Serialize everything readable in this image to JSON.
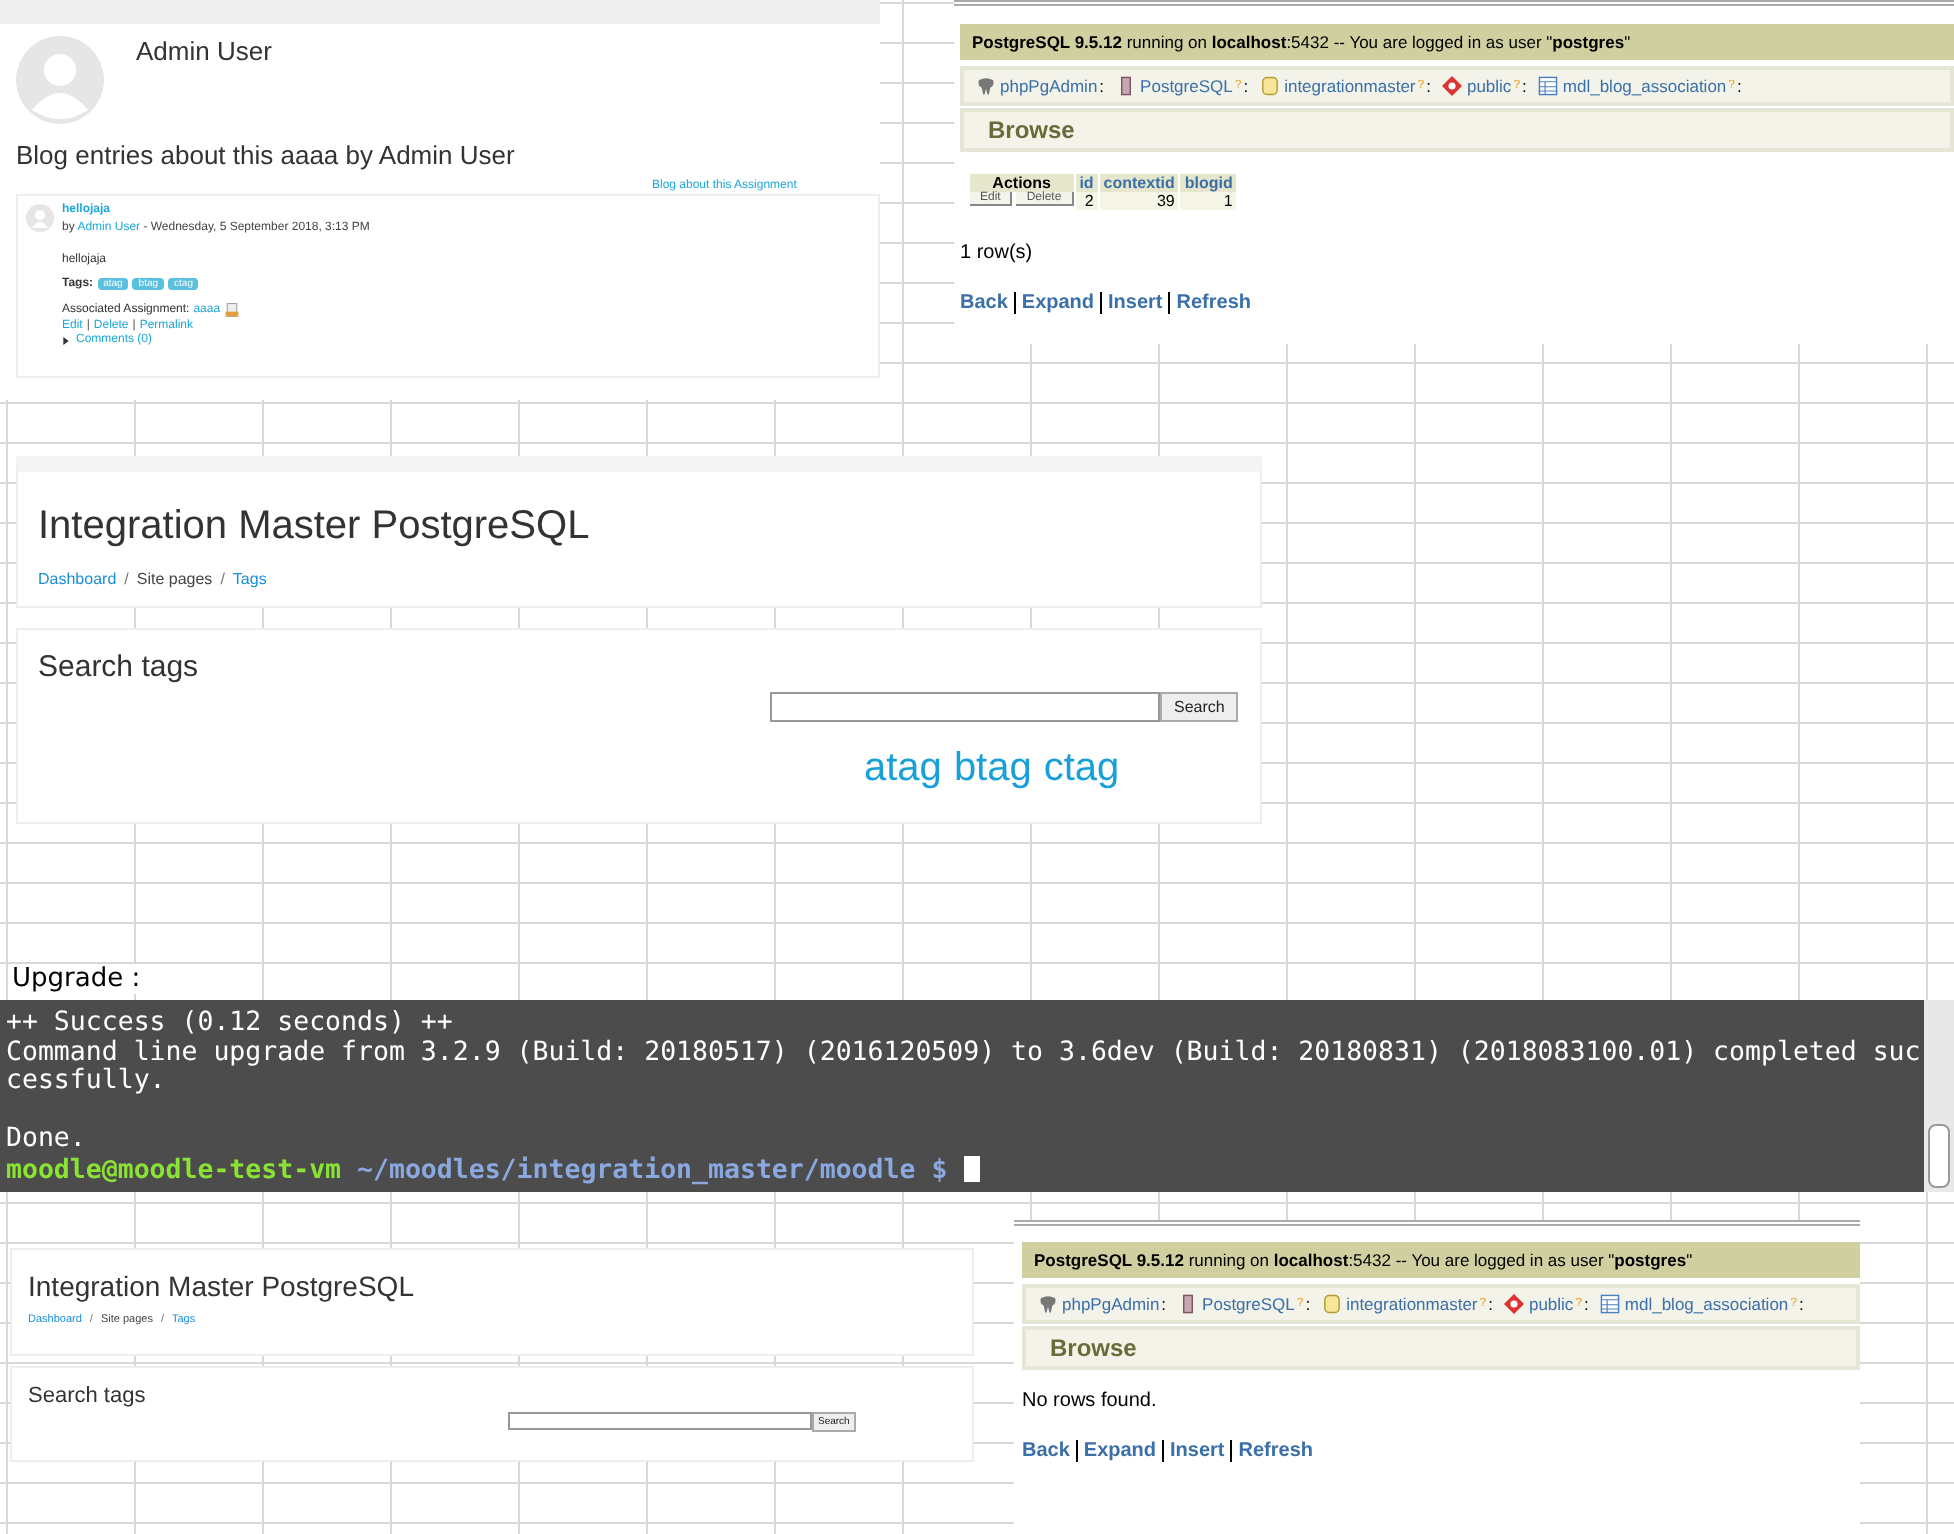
{
  "sheet": {
    "cell_label": "Upgrade :"
  },
  "blog": {
    "author": "Admin User",
    "heading": "Blog entries about this aaaa by Admin User",
    "about_link": "Blog about this Assignment",
    "entry": {
      "title": "hellojaja",
      "by": "by",
      "author": "Admin User",
      "date": "- Wednesday, 5 September 2018, 3:13 PM",
      "body": "hellojaja",
      "tags_label": "Tags:",
      "tags": [
        "atag",
        "btag",
        "ctag"
      ],
      "assoc_label": "Associated Assignment:",
      "assoc_link": "aaaa",
      "actions": [
        "Edit",
        "Delete",
        "Permalink"
      ],
      "action_separator": "|",
      "comments": "Comments (0)"
    }
  },
  "pgadmin": [
    {
      "server_line": "**PostgreSQL 9.5.12** running on **localhost**:5432 -- You are logged in as user \"**postgres**\"",
      "breadcrumbs": [
        {
          "kind": "app",
          "label": "phpPgAdmin",
          "separator": ":"
        },
        {
          "kind": "server",
          "label": "PostgreSQL",
          "help": "?",
          "separator": ":"
        },
        {
          "kind": "database",
          "label": "integrationmaster",
          "help": "?",
          "separator": ":"
        },
        {
          "kind": "schema",
          "label": "public",
          "help": "?",
          "separator": ":"
        },
        {
          "kind": "table",
          "label": "mdl_blog_association",
          "help": "?",
          "separator": ":"
        }
      ],
      "section": "Browse",
      "table": {
        "actions_header": "Actions",
        "columns": [
          "id",
          "contextid",
          "blogid"
        ],
        "rows": [
          {
            "actions": [
              "Edit",
              "Delete"
            ],
            "cells": [
              "2",
              "39",
              "1"
            ]
          }
        ]
      },
      "result": "1 row(s)",
      "links": [
        "Back",
        "Expand",
        "Insert",
        "Refresh"
      ]
    },
    {
      "server_line": "**PostgreSQL 9.5.12** running on **localhost**:5432 -- You are logged in as user \"**postgres**\"",
      "breadcrumbs": [
        {
          "kind": "app",
          "label": "phpPgAdmin",
          "separator": ":"
        },
        {
          "kind": "server",
          "label": "PostgreSQL",
          "help": "?",
          "separator": ":"
        },
        {
          "kind": "database",
          "label": "integrationmaster",
          "help": "?",
          "separator": ":"
        },
        {
          "kind": "schema",
          "label": "public",
          "help": "?",
          "separator": ":"
        },
        {
          "kind": "table",
          "label": "mdl_blog_association",
          "help": "?",
          "separator": ":"
        }
      ],
      "section": "Browse",
      "result": "No rows found.",
      "links": [
        "Back",
        "Expand",
        "Insert",
        "Refresh"
      ]
    }
  ],
  "moodle_tags": [
    {
      "title": "Integration Master PostgreSQL",
      "breadcrumb": [
        {
          "label": "Dashboard",
          "link": true
        },
        {
          "label": "Site pages",
          "link": false
        },
        {
          "label": "Tags",
          "link": true
        }
      ],
      "separator": "/",
      "search_heading": "Search tags",
      "search_button": "Search",
      "tag_cloud": [
        "atag",
        "btag",
        "ctag"
      ]
    },
    {
      "title": "Integration Master PostgreSQL",
      "breadcrumb": [
        {
          "label": "Dashboard",
          "link": true
        },
        {
          "label": "Site pages",
          "link": false
        },
        {
          "label": "Tags",
          "link": true
        }
      ],
      "separator": "/",
      "search_heading": "Search tags",
      "search_button": "Search"
    }
  ],
  "terminal": {
    "lines": [
      {
        "text": "++ Success (0.12 seconds) ++",
        "gap_before": false
      },
      {
        "text": "Command line upgrade from 3.2.9 (Build: 20180517) (2016120509) to 3.6dev (Build: 20180831) (2018083100.01) completed successfully.",
        "gap_before": false
      },
      {
        "text": "Done.",
        "gap_before": true
      }
    ],
    "prompt": {
      "user": "moodle@moodle-test-vm",
      "path": "~/moodles/integration_master/moodle",
      "symbol": "$"
    }
  }
}
